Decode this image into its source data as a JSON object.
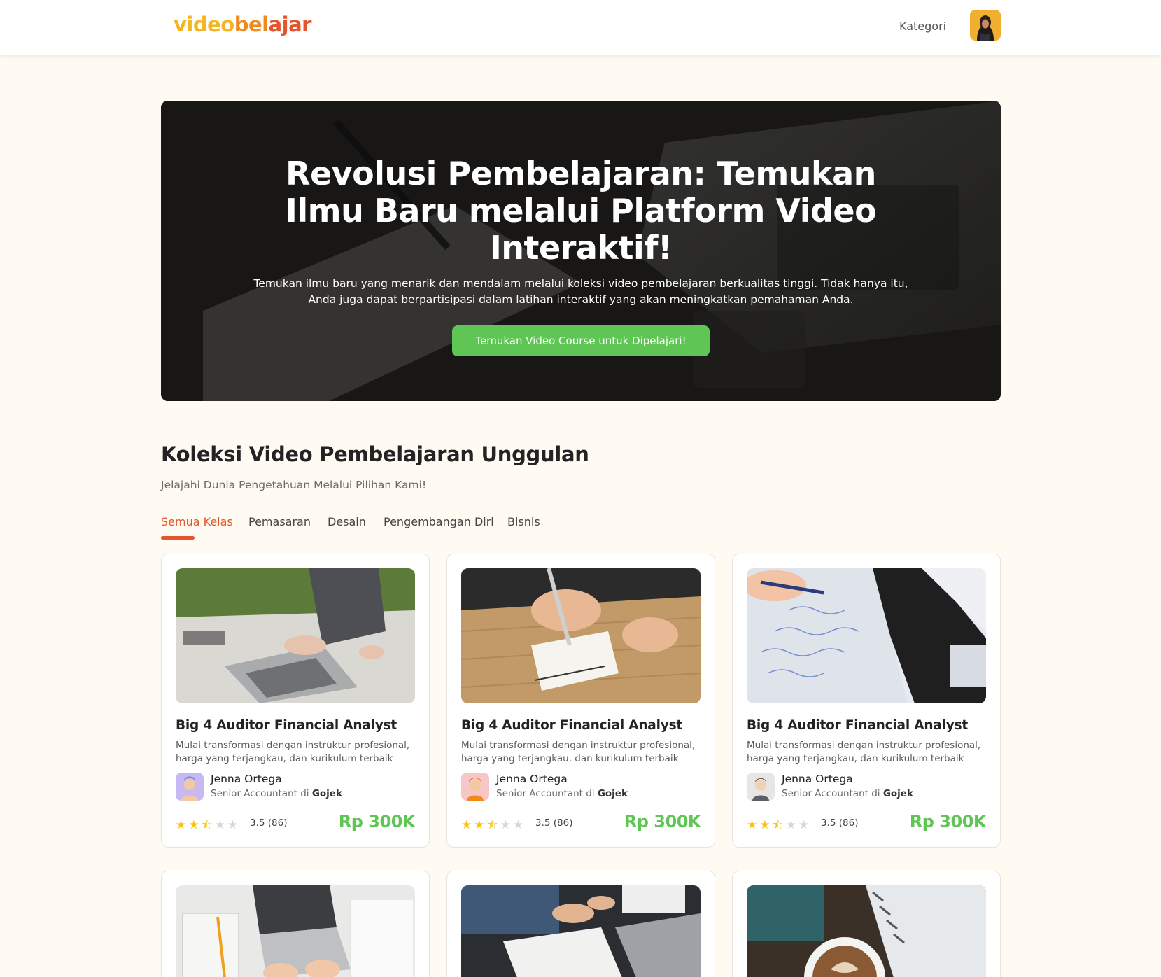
{
  "header": {
    "logo_part1": "video",
    "logo_part2": "bel",
    "logo_part3": "ajar",
    "nav_kategori": "Kategori"
  },
  "hero": {
    "title": "Revolusi Pembelajaran: Temukan Ilmu Baru melalui Platform Video Interaktif!",
    "description": "Temukan ilmu baru yang menarik dan mendalam melalui koleksi video pembelajaran berkualitas tinggi. Tidak hanya itu, Anda juga dapat berpartisipasi dalam latihan interaktif yang akan meningkatkan pemahaman Anda.",
    "cta_label": "Temukan Video Course untuk Dipelajari!"
  },
  "section": {
    "title": "Koleksi Video Pembelajaran Unggulan",
    "subtitle": "Jelajahi Dunia Pengetahuan Melalui Pilihan Kami!"
  },
  "tabs": [
    {
      "label": "Semua Kelas",
      "active": true
    },
    {
      "label": "Pemasaran",
      "active": false
    },
    {
      "label": "Desain",
      "active": false
    },
    {
      "label": "Pengembangan Diri",
      "active": false
    },
    {
      "label": "Bisnis",
      "active": false
    }
  ],
  "cards": [
    {
      "title": "Big 4 Auditor Financial Analyst",
      "description": "Mulai transformasi dengan instruktur profesional, harga yang terjangkau, dan kurikulum terbaik",
      "instructor_name": "Jenna Ortega",
      "instructor_role_prefix": "Senior Accountant di",
      "instructor_company": "Gojek",
      "rating": 3.5,
      "rating_text": "3.5 (86)",
      "price": "Rp 300K",
      "image_icon": "laptop-photo",
      "avatar_icon": "avatar-blue"
    },
    {
      "title": "Big 4 Auditor Financial Analyst",
      "description": "Mulai transformasi dengan instruktur profesional, harga yang terjangkau, dan kurikulum terbaik",
      "instructor_name": "Jenna Ortega",
      "instructor_role_prefix": "Senior Accountant di",
      "instructor_company": "Gojek",
      "rating": 3.5,
      "rating_text": "3.5 (86)",
      "price": "Rp 300K",
      "image_icon": "notebook-photo",
      "avatar_icon": "avatar-red"
    },
    {
      "title": "Big 4 Auditor Financial Analyst",
      "description": "Mulai transformasi dengan instruktur profesional, harga yang terjangkau, dan kurikulum terbaik",
      "instructor_name": "Jenna Ortega",
      "instructor_role_prefix": "Senior Accountant di",
      "instructor_company": "Gojek",
      "rating": 3.5,
      "rating_text": "3.5 (86)",
      "price": "Rp 300K",
      "image_icon": "writing-photo",
      "avatar_icon": "avatar-gray"
    },
    {
      "title": "",
      "description": "",
      "instructor_name": "",
      "instructor_role_prefix": "",
      "instructor_company": "",
      "rating_text": "",
      "price": "",
      "image_icon": "laptop-desk-photo"
    },
    {
      "title": "",
      "description": "",
      "instructor_name": "",
      "instructor_role_prefix": "",
      "instructor_company": "",
      "rating_text": "",
      "price": "",
      "image_icon": "meeting-photo"
    },
    {
      "title": "",
      "description": "",
      "instructor_name": "",
      "instructor_role_prefix": "",
      "instructor_company": "",
      "rating_text": "",
      "price": "",
      "image_icon": "coffee-photo"
    }
  ],
  "colors": {
    "brand_yellow": "#F5B521",
    "brand_orange": "#F08A1E",
    "brand_red": "#E3562D",
    "accent_green": "#5FC656",
    "page_bg": "#FFFBF2"
  }
}
